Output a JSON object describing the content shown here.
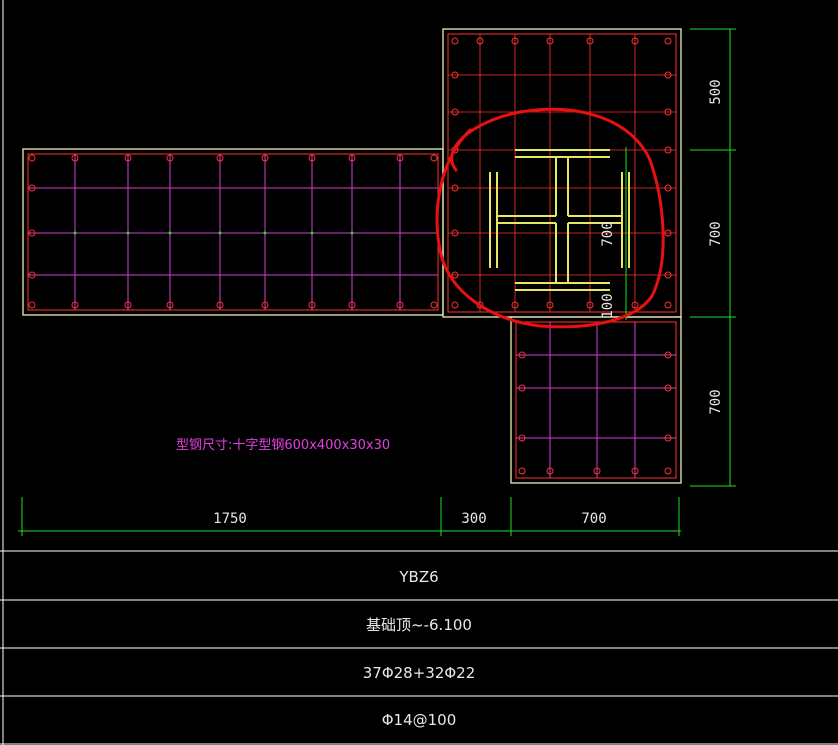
{
  "colors": {
    "background": "#000000",
    "outline": "#ffffc0",
    "rebar_red": "#ff3030",
    "tie_magenta": "#d040d0",
    "dimension_green": "#20e020",
    "steel_yellow": "#e8e860",
    "markup_red": "#e81010",
    "text_white": "#e8e8e8",
    "table_line": "#ffffff"
  },
  "dimensions": {
    "bottom": [
      "1750",
      "300",
      "700"
    ],
    "right": [
      "500",
      "700",
      "700"
    ],
    "inner": [
      "700",
      "100"
    ]
  },
  "steel_note": "型钢尺寸:十字型钢600x400x30x30",
  "table": {
    "rows": [
      "YBZ6",
      "基础顶~-6.100",
      "37Φ28+32Φ22",
      "Φ14@100"
    ]
  }
}
